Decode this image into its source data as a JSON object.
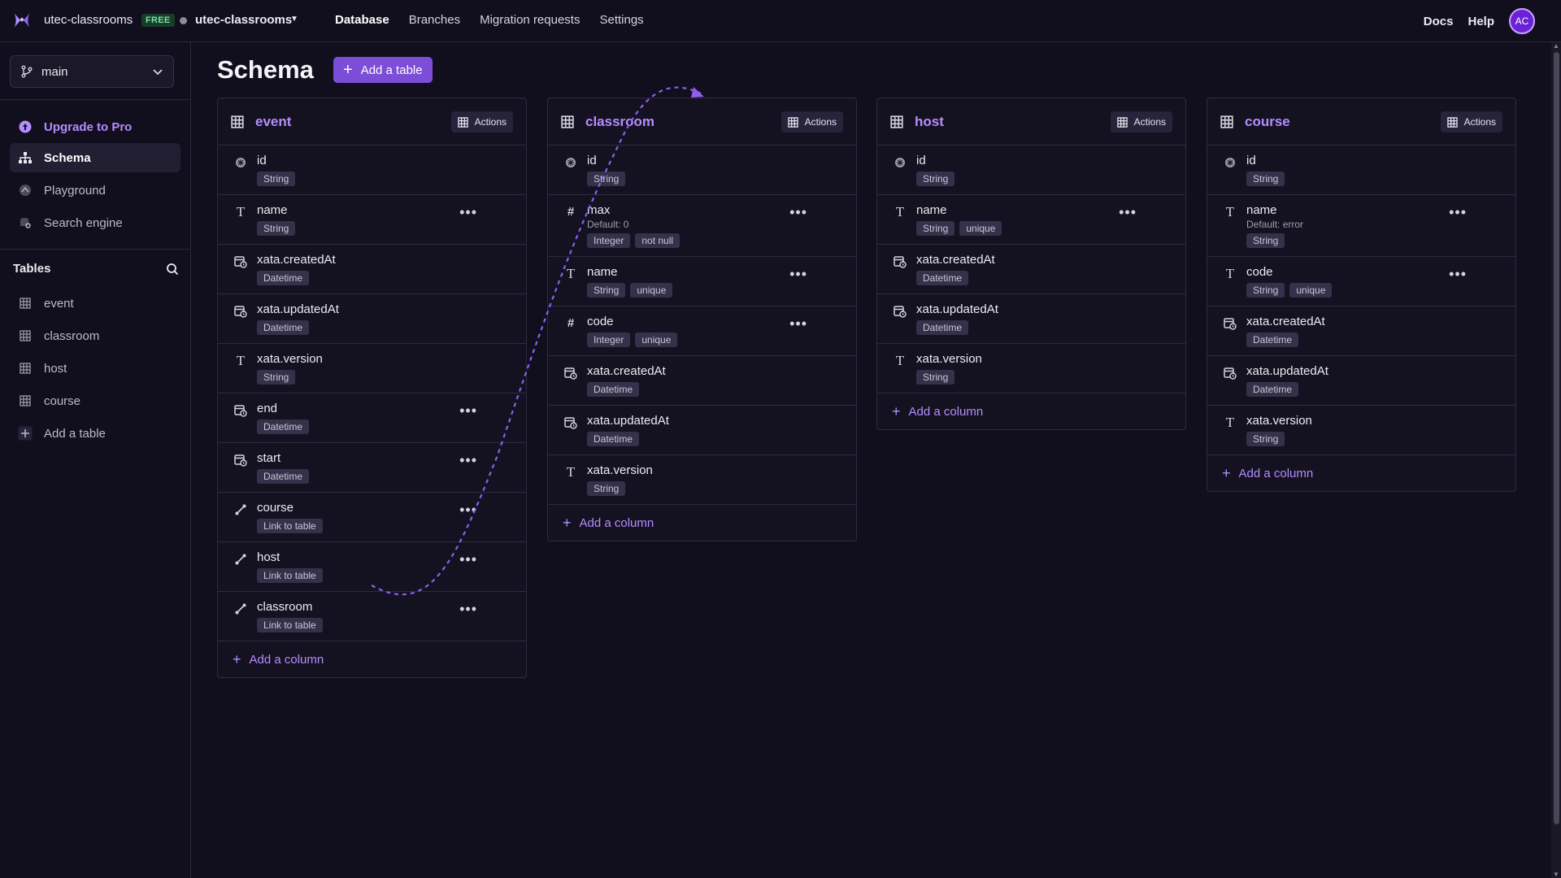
{
  "topbar": {
    "workspace": "utec-classrooms",
    "plan_badge": "FREE",
    "database": "utec-classrooms",
    "nav": [
      "Database",
      "Branches",
      "Migration requests",
      "Settings"
    ],
    "docs": "Docs",
    "help": "Help",
    "avatar_initials": "AC"
  },
  "sidebar": {
    "branch": "main",
    "upgrade": "Upgrade to Pro",
    "items": [
      "Schema",
      "Playground",
      "Search engine"
    ],
    "tables_heading": "Tables",
    "tables": [
      "event",
      "classroom",
      "host",
      "course"
    ],
    "add_table": "Add a table"
  },
  "main": {
    "title": "Schema",
    "add_table_button": "Add a table",
    "actions_label": "Actions",
    "add_column_label": "Add a column"
  },
  "tables": [
    {
      "name": "event",
      "columns": [
        {
          "name": "id",
          "icon": "id-icon",
          "badges": [
            "String"
          ],
          "menu": false
        },
        {
          "name": "name",
          "icon": "text-icon",
          "badges": [
            "String"
          ],
          "menu": true
        },
        {
          "name": "xata.createdAt",
          "icon": "datetime-icon",
          "badges": [
            "Datetime"
          ],
          "menu": false
        },
        {
          "name": "xata.updatedAt",
          "icon": "datetime-icon",
          "badges": [
            "Datetime"
          ],
          "menu": false
        },
        {
          "name": "xata.version",
          "icon": "text-icon",
          "badges": [
            "String"
          ],
          "menu": false
        },
        {
          "name": "end",
          "icon": "datetime-icon",
          "badges": [
            "Datetime"
          ],
          "menu": true
        },
        {
          "name": "start",
          "icon": "datetime-icon",
          "badges": [
            "Datetime"
          ],
          "menu": true
        },
        {
          "name": "course",
          "icon": "link-icon",
          "badges": [
            "Link to table"
          ],
          "menu": true
        },
        {
          "name": "host",
          "icon": "link-icon",
          "badges": [
            "Link to table"
          ],
          "menu": true
        },
        {
          "name": "classroom",
          "icon": "link-icon",
          "badges": [
            "Link to table"
          ],
          "menu": true
        }
      ]
    },
    {
      "name": "classroom",
      "columns": [
        {
          "name": "id",
          "icon": "id-icon",
          "badges": [
            "String"
          ],
          "menu": false
        },
        {
          "name": "max",
          "icon": "number-icon",
          "default": "Default: 0",
          "badges": [
            "Integer",
            "not null"
          ],
          "menu": true
        },
        {
          "name": "name",
          "icon": "text-icon",
          "badges": [
            "String",
            "unique"
          ],
          "menu": true
        },
        {
          "name": "code",
          "icon": "number-icon",
          "badges": [
            "Integer",
            "unique"
          ],
          "menu": true
        },
        {
          "name": "xata.createdAt",
          "icon": "datetime-icon",
          "badges": [
            "Datetime"
          ],
          "menu": false
        },
        {
          "name": "xata.updatedAt",
          "icon": "datetime-icon",
          "badges": [
            "Datetime"
          ],
          "menu": false
        },
        {
          "name": "xata.version",
          "icon": "text-icon",
          "badges": [
            "String"
          ],
          "menu": false
        }
      ]
    },
    {
      "name": "host",
      "columns": [
        {
          "name": "id",
          "icon": "id-icon",
          "badges": [
            "String"
          ],
          "menu": false
        },
        {
          "name": "name",
          "icon": "text-icon",
          "badges": [
            "String",
            "unique"
          ],
          "menu": true
        },
        {
          "name": "xata.createdAt",
          "icon": "datetime-icon",
          "badges": [
            "Datetime"
          ],
          "menu": false
        },
        {
          "name": "xata.updatedAt",
          "icon": "datetime-icon",
          "badges": [
            "Datetime"
          ],
          "menu": false
        },
        {
          "name": "xata.version",
          "icon": "text-icon",
          "badges": [
            "String"
          ],
          "menu": false
        }
      ]
    },
    {
      "name": "course",
      "columns": [
        {
          "name": "id",
          "icon": "id-icon",
          "badges": [
            "String"
          ],
          "menu": false
        },
        {
          "name": "name",
          "icon": "text-icon",
          "default": "Default: error",
          "badges": [
            "String"
          ],
          "menu": true
        },
        {
          "name": "code",
          "icon": "text-icon",
          "badges": [
            "String",
            "unique"
          ],
          "menu": true
        },
        {
          "name": "xata.createdAt",
          "icon": "datetime-icon",
          "badges": [
            "Datetime"
          ],
          "menu": false
        },
        {
          "name": "xata.updatedAt",
          "icon": "datetime-icon",
          "badges": [
            "Datetime"
          ],
          "menu": false
        },
        {
          "name": "xata.version",
          "icon": "text-icon",
          "badges": [
            "String"
          ],
          "menu": false
        }
      ]
    }
  ],
  "colors": {
    "background": "#110f1d",
    "accent": "#b58cff",
    "button": "#7c4dd6",
    "badge": "#34314a"
  }
}
